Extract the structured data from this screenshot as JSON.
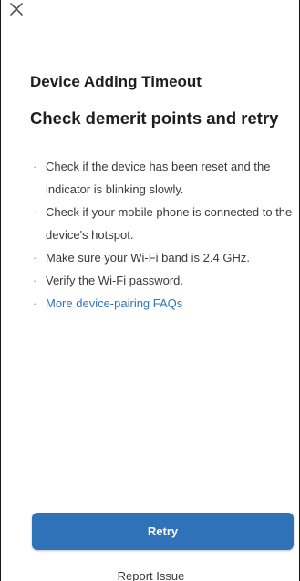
{
  "header": {
    "close_icon": "close-icon"
  },
  "title": "Device Adding Timeout",
  "subtitle": "Check demerit points and retry",
  "tips": [
    {
      "bullet": "·",
      "text": "Check if the device has been reset and the indicator is blinking slowly."
    },
    {
      "bullet": "·",
      "text": "Check if your mobile phone is connected to the device's hotspot."
    },
    {
      "bullet": "·",
      "text": "Make sure your Wi-Fi band is 2.4 GHz."
    },
    {
      "bullet": "·",
      "text": "Verify the Wi-Fi password."
    },
    {
      "bullet": "·",
      "text": "More device-pairing FAQs"
    }
  ],
  "actions": {
    "retry_label": "Retry",
    "report_label": "Report Issue"
  },
  "colors": {
    "accent": "#2f72b8",
    "link": "#2e74b8"
  }
}
